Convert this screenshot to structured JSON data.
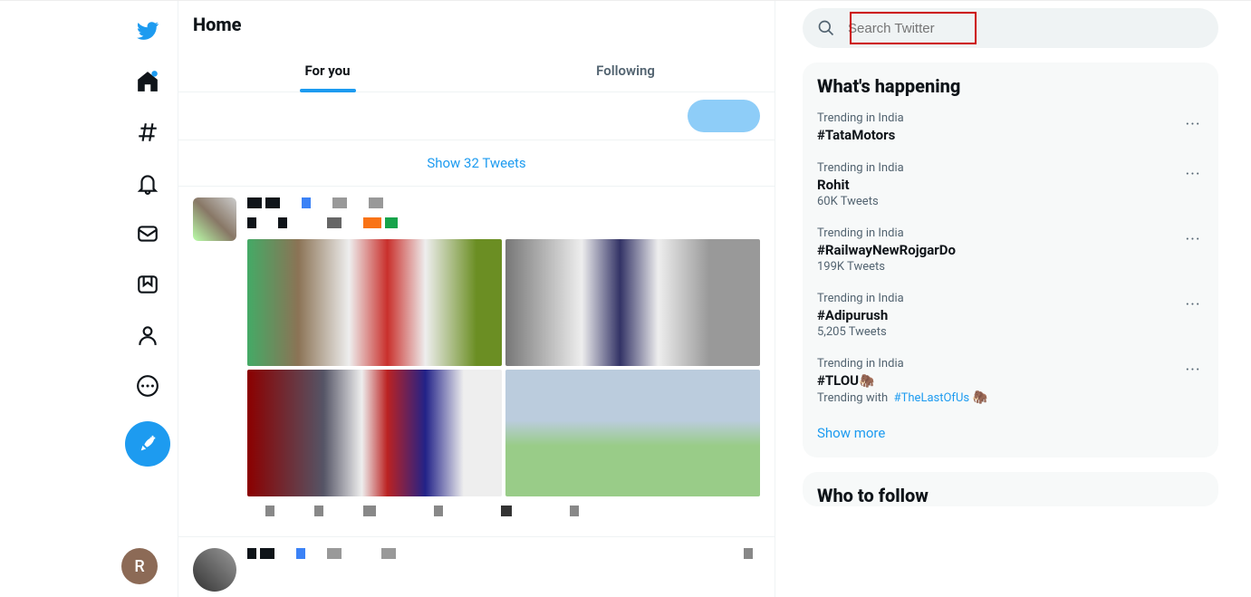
{
  "header": {
    "title": "Home"
  },
  "tabs": {
    "for_you": "For you",
    "following": "Following",
    "active": "for_you"
  },
  "show_tweets": "Show 32 Tweets",
  "search": {
    "placeholder": "Search Twitter"
  },
  "avatar_letter": "R",
  "whats_happening": {
    "title": "What's happening",
    "trends": [
      {
        "context": "Trending in India",
        "topic": "#TataMotors",
        "count": ""
      },
      {
        "context": "Trending in India",
        "topic": "Rohit",
        "count": "60K Tweets"
      },
      {
        "context": "Trending in India",
        "topic": "#RailwayNewRojgarDo",
        "count": "199K Tweets"
      },
      {
        "context": "Trending in India",
        "topic": "#Adipurush",
        "count": "5,205 Tweets"
      },
      {
        "context": "Trending in India",
        "topic": "#TLOU",
        "emoji": "🦣",
        "trending_with_prefix": "Trending with",
        "trending_with": "#TheLastOfUs",
        "trending_with_emoji": "🦣"
      }
    ],
    "show_more": "Show more"
  },
  "who_to_follow": {
    "title": "Who to follow"
  },
  "colors": {
    "accent": "#1d9bf0",
    "highlight": "#cc0000"
  }
}
